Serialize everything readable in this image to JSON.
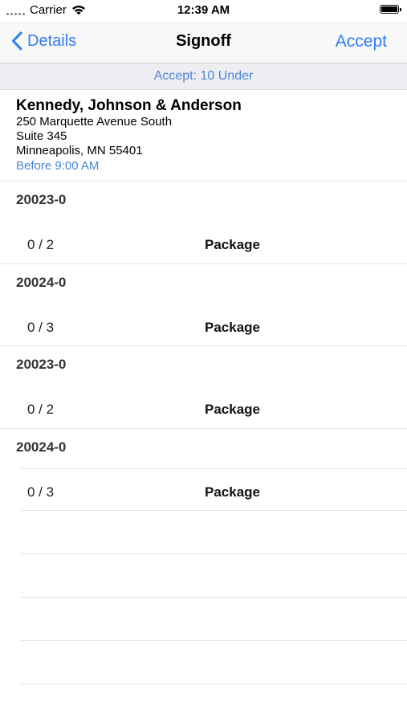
{
  "status_bar": {
    "carrier": "Carrier",
    "time": "12:39 AM"
  },
  "nav": {
    "back_label": "Details",
    "title": "Signoff",
    "accept_label": "Accept"
  },
  "banner": {
    "text": "Accept: 10 Under"
  },
  "address": {
    "name": "Kennedy, Johnson & Anderson",
    "line1": "250 Marquette Avenue South",
    "line2": "Suite 345",
    "line3": "Minneapolis, MN 55401",
    "time_window": "Before 9:00 AM"
  },
  "groups": [
    {
      "id": "20023-0",
      "count": "0 / 2",
      "type": "Package"
    },
    {
      "id": "20024-0",
      "count": "0 / 3",
      "type": "Package"
    },
    {
      "id": "20023-0",
      "count": "0 / 2",
      "type": "Package"
    },
    {
      "id": "20024-0",
      "count": "0 / 3",
      "type": "Package"
    }
  ],
  "colors": {
    "accent": "#2f7cf6",
    "banner_text": "#4a86d8",
    "banner_bg": "#eeeef2"
  }
}
